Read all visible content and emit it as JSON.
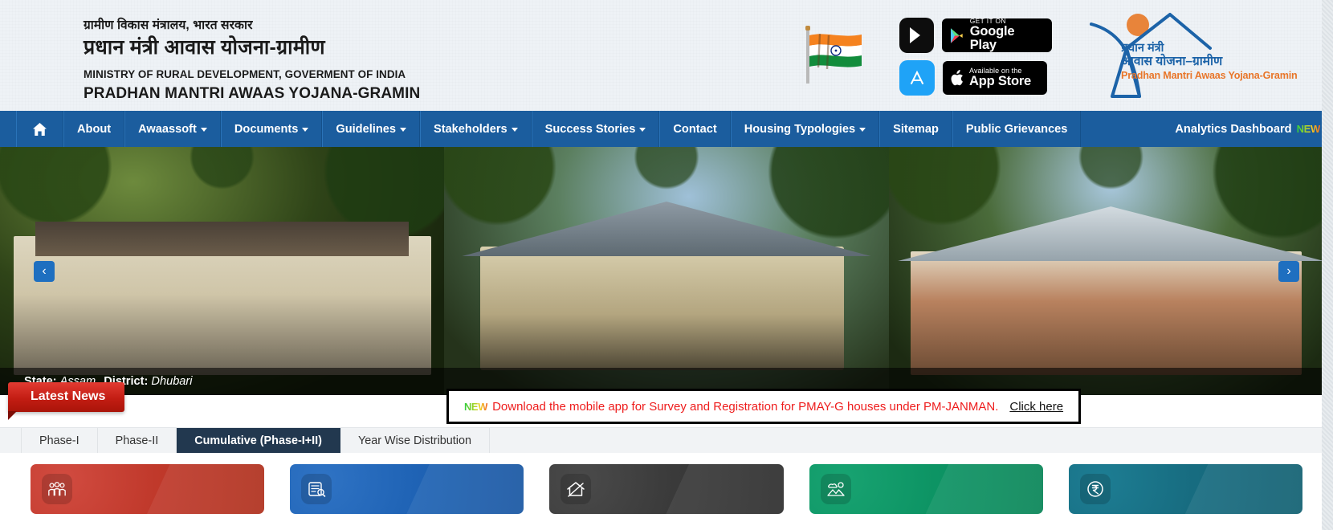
{
  "header": {
    "ministry_hi": "ग्रामीण विकास मंत्रालय, भारत सरकार",
    "scheme_hi": "प्रधान मंत्री आवास योजना-ग्रामीण",
    "ministry_en": "MINISTRY OF RURAL DEVELOPMENT, GOVERMENT OF INDIA",
    "scheme_en": "PRADHAN MANTRI AWAAS YOJANA-GRAMIN",
    "flag_icon": "india-flag-icon",
    "play_tile_icon": "google-play-icon",
    "ios_tile_icon": "app-store-icon",
    "google_play": {
      "small": "GET IT ON",
      "big": "Google Play"
    },
    "app_store": {
      "small": "Available on the",
      "big": "App Store"
    },
    "logo": {
      "line1": "प्रधान मंत्री",
      "line2": "आवास योजना–ग्रामीण",
      "line3": "Pradhan Mantri Awaas Yojana-Gramin",
      "accent_blue": "#1c63a8",
      "accent_orange": "#e8762a"
    }
  },
  "nav": {
    "home_icon": "home-icon",
    "items": [
      {
        "label": "About",
        "caret": false
      },
      {
        "label": "Awaassoft",
        "caret": true
      },
      {
        "label": "Documents",
        "caret": true
      },
      {
        "label": "Guidelines",
        "caret": true
      },
      {
        "label": "Stakeholders",
        "caret": true
      },
      {
        "label": "Success Stories",
        "caret": true
      },
      {
        "label": "Contact",
        "caret": false
      },
      {
        "label": "Housing Typologies",
        "caret": true
      },
      {
        "label": "Sitemap",
        "caret": false
      },
      {
        "label": "Public Grievances",
        "caret": false
      }
    ],
    "right_label": "Analytics Dashboard",
    "right_badge": "NEW",
    "bg_color": "#1b5d9e"
  },
  "carousel": {
    "prev_icon": "chevron-left-icon",
    "next_icon": "chevron-right-icon",
    "prev_glyph": "‹",
    "next_glyph": "›",
    "caption": {
      "state_label": "State:",
      "state_value": "Assam",
      "district_label": "District:",
      "district_value": "Dhubari"
    }
  },
  "news": {
    "ribbon_label": "Latest News",
    "badge": "NEW",
    "text": "Download the mobile app for Survey and Registration for PMAY-G houses under PM-JANMAN.",
    "link": "Click here",
    "text_color": "#ee1c1c"
  },
  "tabs": [
    {
      "label": "Phase-I",
      "active": false
    },
    {
      "label": "Phase-II",
      "active": false
    },
    {
      "label": "Cumulative (Phase-I+II)",
      "active": true
    },
    {
      "label": "Year Wise Distribution",
      "active": false
    }
  ],
  "cards": [
    {
      "icon": "people-group-icon",
      "color": "#c0392b",
      "theme": "c-red"
    },
    {
      "icon": "document-register-icon",
      "color": "#1f63b5",
      "theme": "c-blue"
    },
    {
      "icon": "house-sanction-icon",
      "color": "#3a3a3a",
      "theme": "c-dark"
    },
    {
      "icon": "landscape-completed-icon",
      "color": "#0d9464",
      "theme": "c-green"
    },
    {
      "icon": "rupee-icon",
      "color": "#176c80",
      "theme": "c-teal"
    }
  ]
}
